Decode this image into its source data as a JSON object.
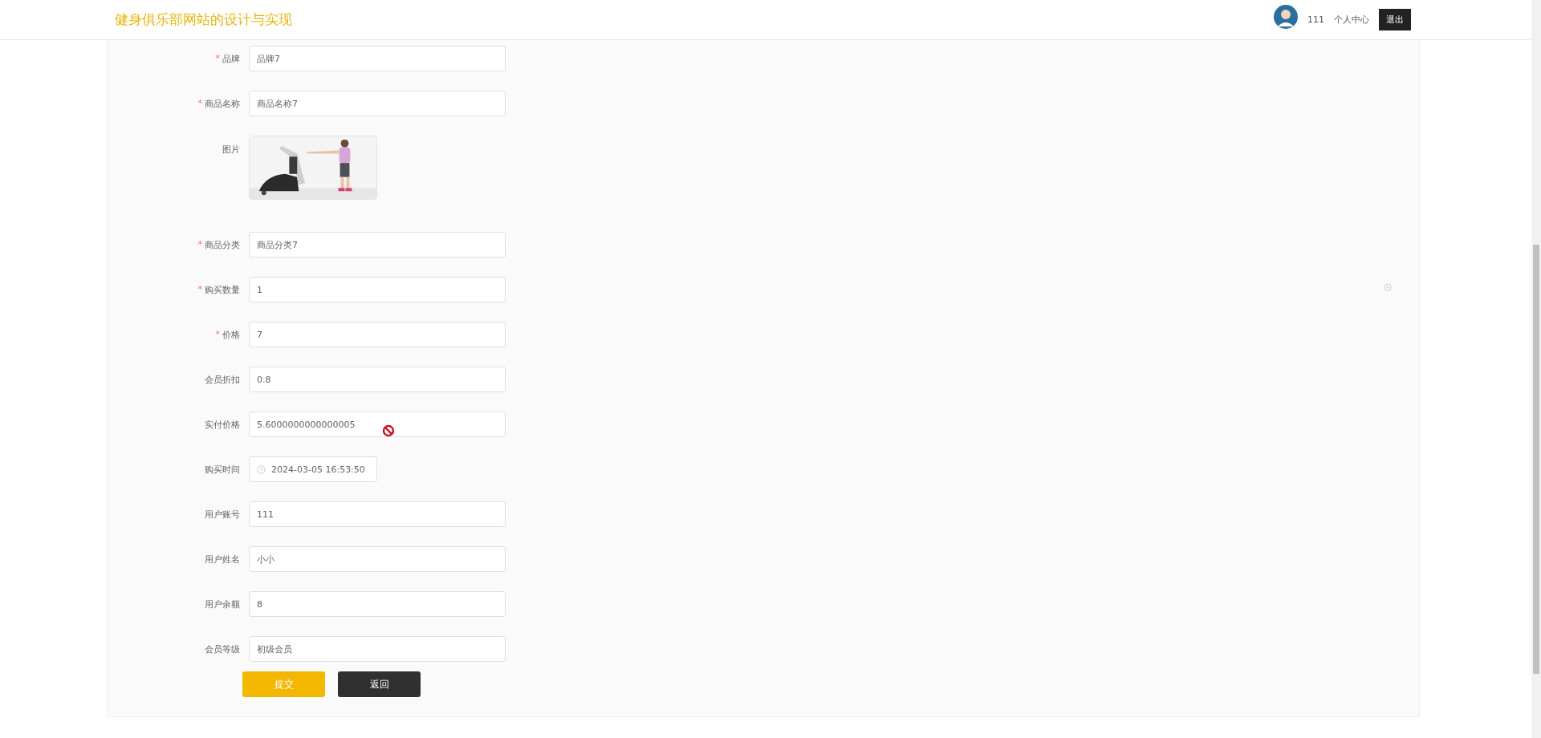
{
  "header": {
    "site_title": "健身俱乐部网站的设计与实现",
    "username": "111",
    "profile_link": "个人中心",
    "logout_button": "退出"
  },
  "form": {
    "required_marker": "*",
    "fields": [
      {
        "kind": "text",
        "label": "品牌",
        "required": true,
        "value": "品牌7"
      },
      {
        "kind": "text",
        "label": "商品名称",
        "required": true,
        "value": "商品名称7"
      },
      {
        "label": "图片",
        "required": false
      },
      {
        "kind": "text",
        "label": "商品分类",
        "required": true,
        "value": "商品分类7"
      },
      {
        "kind": "text",
        "label": "购买数量",
        "required": true,
        "value": "1"
      },
      {
        "kind": "text",
        "label": "价格",
        "required": true,
        "value": "7"
      },
      {
        "kind": "text",
        "label": "会员折扣",
        "required": false,
        "value": "0.8"
      },
      {
        "kind": "text",
        "label": "实付价格",
        "required": false,
        "value": "5.6000000000000005"
      },
      {
        "kind": "datetime",
        "label": "购买时间",
        "required": false,
        "value": "2024-03-05 16:53:50"
      },
      {
        "kind": "text",
        "label": "用户账号",
        "required": false,
        "value": "111"
      },
      {
        "kind": "text",
        "label": "用户姓名",
        "required": false,
        "value": "小小"
      },
      {
        "kind": "text",
        "label": "用户余额",
        "required": false,
        "value": "8"
      },
      {
        "kind": "text",
        "label": "会员等级",
        "required": false,
        "value": "初级会员"
      }
    ],
    "buttons": [
      {
        "kind": "primary",
        "label": "提交"
      },
      {
        "kind": "dark",
        "label": "返回"
      }
    ]
  }
}
